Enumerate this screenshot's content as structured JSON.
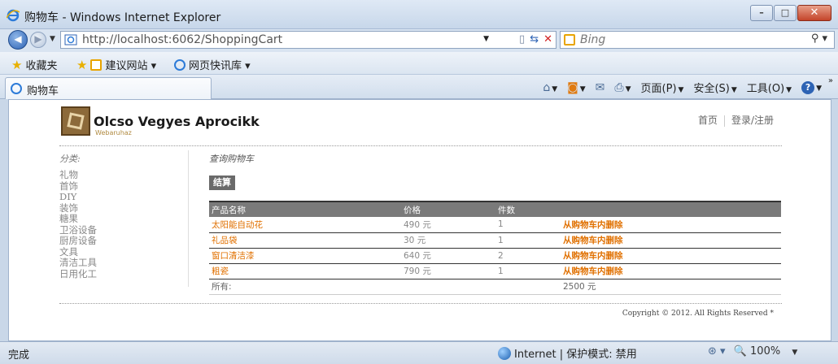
{
  "window": {
    "title": "购物车 - Windows Internet Explorer",
    "buttons": {
      "minimize": "–",
      "maximize": "□",
      "close": "✕"
    }
  },
  "address": {
    "url": "http://localhost:6062/ShoppingCart",
    "search_placeholder": "Bing"
  },
  "favorites": {
    "label": "收藏夹",
    "suggested": "建议网站 ▾",
    "webslice": "网页快讯库 ▾"
  },
  "tab": {
    "label": "购物车"
  },
  "commands": {
    "page": "页面(P)",
    "safety": "安全(S)",
    "tools": "工具(O)"
  },
  "site": {
    "title": "Olcso Vegyes Aprocikk",
    "subtitle": "Webaruhaz",
    "nav": {
      "home": "首页",
      "login": "登录/注册"
    }
  },
  "sidebar": {
    "title": "分类:",
    "items": [
      "礼物",
      "首饰",
      "DIY",
      "装饰",
      "糖果",
      "卫浴设备",
      "厨房设备",
      "文具",
      "清洁工具",
      "日用化工"
    ]
  },
  "main": {
    "breadcrumb": "查询购物车",
    "checkout_label": "结算"
  },
  "cart": {
    "headers": [
      "产品名称",
      "价格",
      "件数",
      ""
    ],
    "rows": [
      {
        "name": "太阳能自动花",
        "price": "490 元",
        "qty": "1",
        "action": "从购物车内删除"
      },
      {
        "name": "礼品袋",
        "price": "30 元",
        "qty": "1",
        "action": "从购物车内删除"
      },
      {
        "name": "窗口清洁漆",
        "price": "640 元",
        "qty": "2",
        "action": "从购物车内删除"
      },
      {
        "name": "粗瓷",
        "price": "790 元",
        "qty": "1",
        "action": "从购物车内删除"
      }
    ],
    "total_label": "所有:",
    "total_value": "2500 元"
  },
  "footer": {
    "copyright": "Copyright © 2012. All Rights Reserved *"
  },
  "status": {
    "text": "完成",
    "zone": "Internet | 保护模式: 禁用",
    "zoom": "100%"
  }
}
